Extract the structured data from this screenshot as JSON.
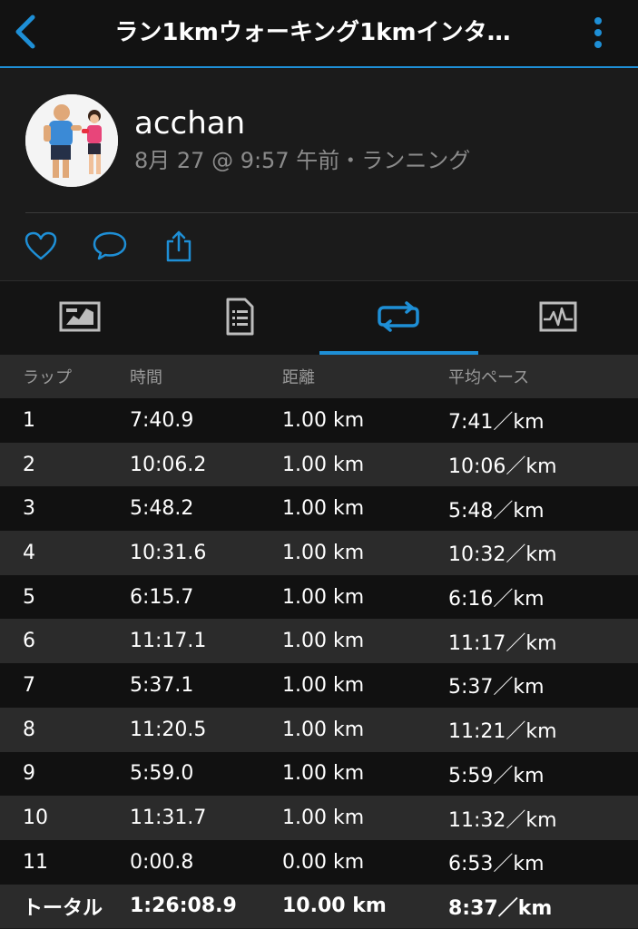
{
  "header": {
    "title": "ラン1kmウォーキング1kmインタ…",
    "back_icon": "back-chevron-icon",
    "menu_icon": "more-vertical-icon",
    "accent_color": "#1e8fd6"
  },
  "profile": {
    "username": "acchan",
    "meta": "8月 27 @ 9:57 午前・ランニング"
  },
  "actions": [
    {
      "icon": "heart-icon"
    },
    {
      "icon": "comment-icon"
    },
    {
      "icon": "share-icon"
    }
  ],
  "tabs": [
    {
      "icon": "map-icon",
      "active": false
    },
    {
      "icon": "details-icon",
      "active": false
    },
    {
      "icon": "laps-icon",
      "active": true
    },
    {
      "icon": "chart-icon",
      "active": false
    }
  ],
  "table": {
    "headers": [
      "ラップ",
      "時間",
      "距離",
      "平均ペース"
    ],
    "rows": [
      [
        "1",
        "7:40.9",
        "1.00 km",
        "7:41／km"
      ],
      [
        "2",
        "10:06.2",
        "1.00 km",
        "10:06／km"
      ],
      [
        "3",
        "5:48.2",
        "1.00 km",
        "5:48／km"
      ],
      [
        "4",
        "10:31.6",
        "1.00 km",
        "10:32／km"
      ],
      [
        "5",
        "6:15.7",
        "1.00 km",
        "6:16／km"
      ],
      [
        "6",
        "11:17.1",
        "1.00 km",
        "11:17／km"
      ],
      [
        "7",
        "5:37.1",
        "1.00 km",
        "5:37／km"
      ],
      [
        "8",
        "11:20.5",
        "1.00 km",
        "11:21／km"
      ],
      [
        "9",
        "5:59.0",
        "1.00 km",
        "5:59／km"
      ],
      [
        "10",
        "11:31.7",
        "1.00 km",
        "11:32／km"
      ],
      [
        "11",
        "0:00.8",
        "0.00 km",
        "6:53／km"
      ]
    ],
    "total": [
      "トータル",
      "1:26:08.9",
      "10.00 km",
      "8:37／km"
    ]
  }
}
